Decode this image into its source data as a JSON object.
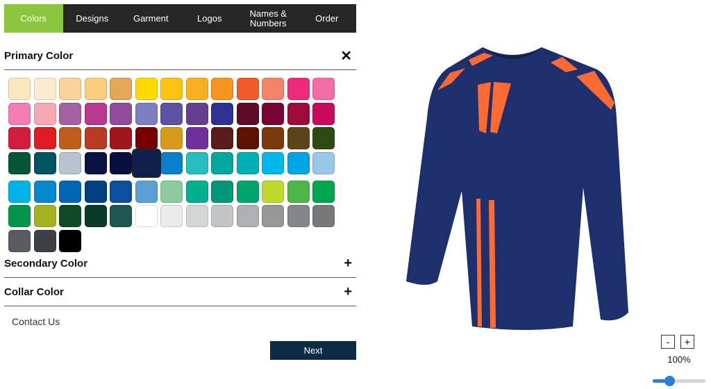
{
  "tabs": [
    {
      "label": "Colors",
      "active": true
    },
    {
      "label": "Designs",
      "active": false
    },
    {
      "label": "Garment",
      "active": false
    },
    {
      "label": "Logos",
      "active": false
    },
    {
      "label": "Names & Numbers",
      "active": false
    },
    {
      "label": "Order",
      "active": false
    }
  ],
  "sections": {
    "primary": {
      "title": "Primary Color",
      "toggle": "✕",
      "expanded": true
    },
    "secondary": {
      "title": "Secondary Color",
      "toggle": "+",
      "expanded": false
    },
    "collar": {
      "title": "Collar Color",
      "toggle": "+",
      "expanded": false
    }
  },
  "palette": [
    "#fbe7c0",
    "#fdebd0",
    "#fbd39a",
    "#fbcd7d",
    "#e2a856",
    "#ffd800",
    "#ffc20e",
    "#fbae1f",
    "#f7941d",
    "#f15a29",
    "#f5836a",
    "#ee2a7b",
    "#f26ea5",
    "#f27db2",
    "#f6a8b5",
    "#a45fa6",
    "#b8398f",
    "#8f4b9c",
    "#7b7fc2",
    "#5d51a1",
    "#653f8f",
    "#2e3192",
    "#5d0a2b",
    "#770432",
    "#9d0b3b",
    "#c8095c",
    "#d21e3c",
    "#e11b22",
    "#c05c1a",
    "#b73a22",
    "#a1151b",
    "#760000",
    "#d89a1c",
    "#70309a",
    "#5b1b1b",
    "#5c1200",
    "#7b3a0a",
    "#5b4518",
    "#2f4a11",
    "#065535",
    "#005461",
    "#b7c3cf",
    "#081342",
    "#0a0e3e",
    "#0f1e4a",
    "#0b7fcc",
    "#27bcc1",
    "#00a89d",
    "#00aeb5",
    "#00b7e9",
    "#00a4e4",
    "#96c9ea",
    "#00b3e6",
    "#0587cc",
    "#0066b3",
    "#023f80",
    "#0a4f9f",
    "#5aa0d4",
    "#8ccba0",
    "#00b08e",
    "#009678",
    "#00a46f",
    "#c1d82f",
    "#4eb648",
    "#00a550",
    "#00974b",
    "#a3b320",
    "#0c4b25",
    "#073b26",
    "#1d5652",
    "#ffffff",
    "#ebebeb",
    "#d5d6d8",
    "#c3c4c6",
    "#aeb0b3",
    "#96989b",
    "#848689",
    "#76787b",
    "#5b5c61",
    "#3f4045",
    "#000000"
  ],
  "selected_color_index": 44,
  "contact_label": "Contact Us",
  "next_label": "Next",
  "zoom": {
    "minus": "-",
    "plus": "+",
    "percent": "100%",
    "level": 0.31
  },
  "preview": {
    "jersey_color": "#1e2f6e",
    "accent_color": "#ff6a33"
  }
}
